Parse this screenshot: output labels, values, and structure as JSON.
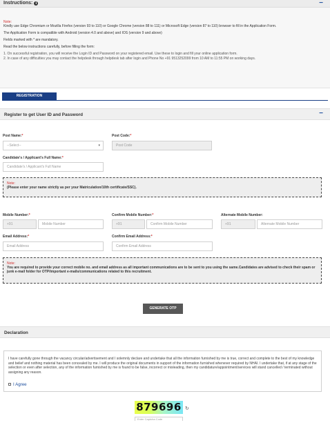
{
  "instructions": {
    "title": "Instructions:",
    "collapse": "−",
    "note_label": "Note:",
    "lines": [
      "Kindly use Edge Chromium or Mozilla Firefox (version 93 to 110) or Google Chrome (version 88 to 111) or Microsoft Edge (version 87 to 110) browser to fill in the Application Form.",
      "The Application Form is compatible with Android (version 4.0 and above) and IOS (version 9 and above)",
      "Fields marked with * are mandatory.",
      "Read the below instructions carefully, before filling the form:"
    ],
    "list": [
      "1. On successful registration, you will receive the Login ID and Password on your registered email. Use these to login and fill your online application form.",
      "2. In case of any difficulties you may contact the helpdesk through helpdesk tab after login and Phone No +91 9513252099 from 10 AM to 11:55 PM on working days."
    ]
  },
  "tab": {
    "label": "REGISTRATION"
  },
  "register_section": {
    "title": "Register to get User ID and Password",
    "collapse": "−"
  },
  "form": {
    "req_mark": "*",
    "post_name": {
      "label": "Post Name:",
      "placeholder": "--Select--"
    },
    "post_code": {
      "label": "Post Code:",
      "placeholder": "Post Code"
    },
    "candidate_name": {
      "label": "Candidate's / Applicant's Full Name:",
      "placeholder": "Candidate's / Applicant's Full Name"
    },
    "note1": {
      "label": "Note:",
      "text": "(Please enter your name strictly as per your Matriculation/10th certificate/SSC)."
    },
    "mobile": {
      "label": "Mobile Number:",
      "prefix": "+91",
      "placeholder": "Mobile Number"
    },
    "confirm_mobile": {
      "label": "Confirm Mobile Number:",
      "prefix": "+91",
      "placeholder": "Confirm Mobile Number"
    },
    "alt_mobile": {
      "label": "Alternate Mobile Number:",
      "prefix": "+91",
      "placeholder": "Alternate Mobile Number"
    },
    "email": {
      "label": "Email Address:",
      "placeholder": "Email Address"
    },
    "confirm_email": {
      "label": "Confirm Email Address:",
      "placeholder": "Confirm Email Address"
    },
    "note2": {
      "label": "Note:",
      "text": "You are required to provide your correct mobile no. and email address as all important communications are to be sent to you using the same.Candidates are advised to check their spam or junk e-mail folder for OTP/important e-mails/communications related to this recruitment."
    },
    "generate_otp": "GENERATE OTP"
  },
  "declaration": {
    "title": "Declaration",
    "text": "I have carefully gone through the vacancy circular/advertisement and I solemnly declare and undertake that all the information furnished by me is true, correct and complete to the best of my knowledge and belief and nothing material has been concealed by me. I will produce the original documents in support of the information furnished whenever required by NHAI. I undertake that, if at any stage of the selection or even after selection, any of the information furnished by me is found to be false, incorrect or misleading, then my candidature/appointment/services will stand cancelled / terminated without assigning any reason.",
    "agree_label": "I Agree"
  },
  "captcha": {
    "code": "879696",
    "refresh_icon": "refresh-icon",
    "placeholder": "Enter Captcha Code"
  },
  "colors": {
    "brand_blue": "#1a3f85",
    "required_red": "#d12f2f",
    "button_gray": "#575757"
  }
}
